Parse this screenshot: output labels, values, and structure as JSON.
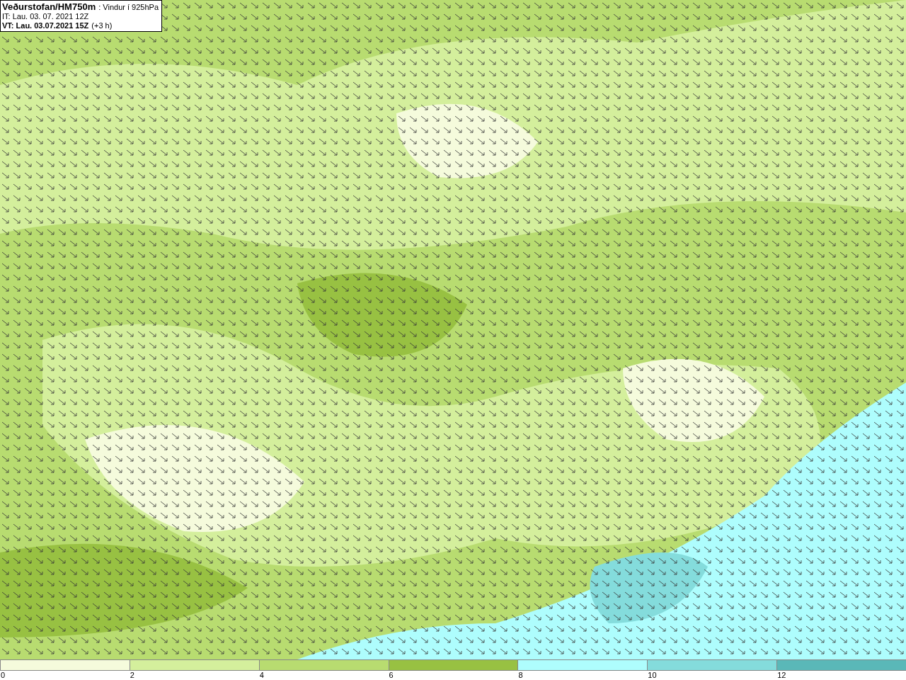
{
  "header": {
    "title": "Veðurstofan/HM750m",
    "subtitle": ": Vindur í 925hPa",
    "initial_time": "IT: Lau. 03. 07. 2021 12Z",
    "valid_time": "VT: Lau. 03.07.2021 15Z",
    "lead": "(+3 h)"
  },
  "legend": [
    {
      "label": "0",
      "color": "#f5fbdc"
    },
    {
      "label": "2",
      "color": "#d4ef9c"
    },
    {
      "label": "4",
      "color": "#b8dc70"
    },
    {
      "label": "6",
      "color": "#98c142"
    },
    {
      "label": "8",
      "color": "#aefdfd"
    },
    {
      "label": "10",
      "color": "#84dcdc"
    },
    {
      "label": "12",
      "color": "#5ab8b8"
    }
  ]
}
